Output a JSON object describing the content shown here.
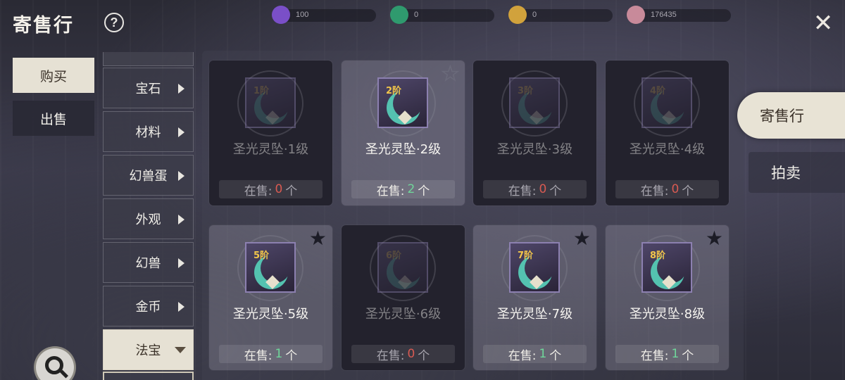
{
  "header": {
    "title": "寄售行",
    "help_label": "?",
    "close_label": "✕",
    "currencies": [
      {
        "icon": "purple-gem-icon",
        "color": "#7a4fc8",
        "amount": "100"
      },
      {
        "icon": "green-gem-icon",
        "color": "#2f9a6e",
        "amount": "0"
      },
      {
        "icon": "gold-coin-icon",
        "color": "#d1a23c",
        "amount": "0"
      },
      {
        "icon": "pink-orb-icon",
        "color": "#c88a9a",
        "amount": "176435"
      }
    ]
  },
  "tabs": {
    "buy": "购买",
    "sell": "出售"
  },
  "categories": [
    {
      "label": "宝石",
      "active": false
    },
    {
      "label": "材料",
      "active": false
    },
    {
      "label": "幻兽蛋",
      "active": false
    },
    {
      "label": "外观",
      "active": false
    },
    {
      "label": "幻兽",
      "active": false
    },
    {
      "label": "金币",
      "active": false
    },
    {
      "label": "法宝",
      "active": true
    }
  ],
  "stock_prefix": "在售:",
  "stock_suffix": "个",
  "items": [
    {
      "name": "圣光灵坠·1级",
      "tier": "1阶",
      "count": "0",
      "favorite": false,
      "highlighted": false,
      "dimmed": true
    },
    {
      "name": "圣光灵坠·2级",
      "tier": "2阶",
      "count": "2",
      "favorite": false,
      "highlighted": true,
      "dimmed": false
    },
    {
      "name": "圣光灵坠·3级",
      "tier": "3阶",
      "count": "0",
      "favorite": false,
      "highlighted": false,
      "dimmed": true
    },
    {
      "name": "圣光灵坠·4级",
      "tier": "4阶",
      "count": "0",
      "favorite": false,
      "highlighted": false,
      "dimmed": true
    },
    {
      "name": "圣光灵坠·5级",
      "tier": "5阶",
      "count": "1",
      "favorite": true,
      "highlighted": true,
      "dimmed": false
    },
    {
      "name": "圣光灵坠·6级",
      "tier": "6阶",
      "count": "0",
      "favorite": false,
      "highlighted": false,
      "dimmed": true
    },
    {
      "name": "圣光灵坠·7级",
      "tier": "7阶",
      "count": "1",
      "favorite": true,
      "highlighted": true,
      "dimmed": false
    },
    {
      "name": "圣光灵坠·8级",
      "tier": "8阶",
      "count": "1",
      "favorite": true,
      "highlighted": true,
      "dimmed": false
    }
  ],
  "right_tabs": {
    "consign": "寄售行",
    "auction": "拍卖"
  }
}
